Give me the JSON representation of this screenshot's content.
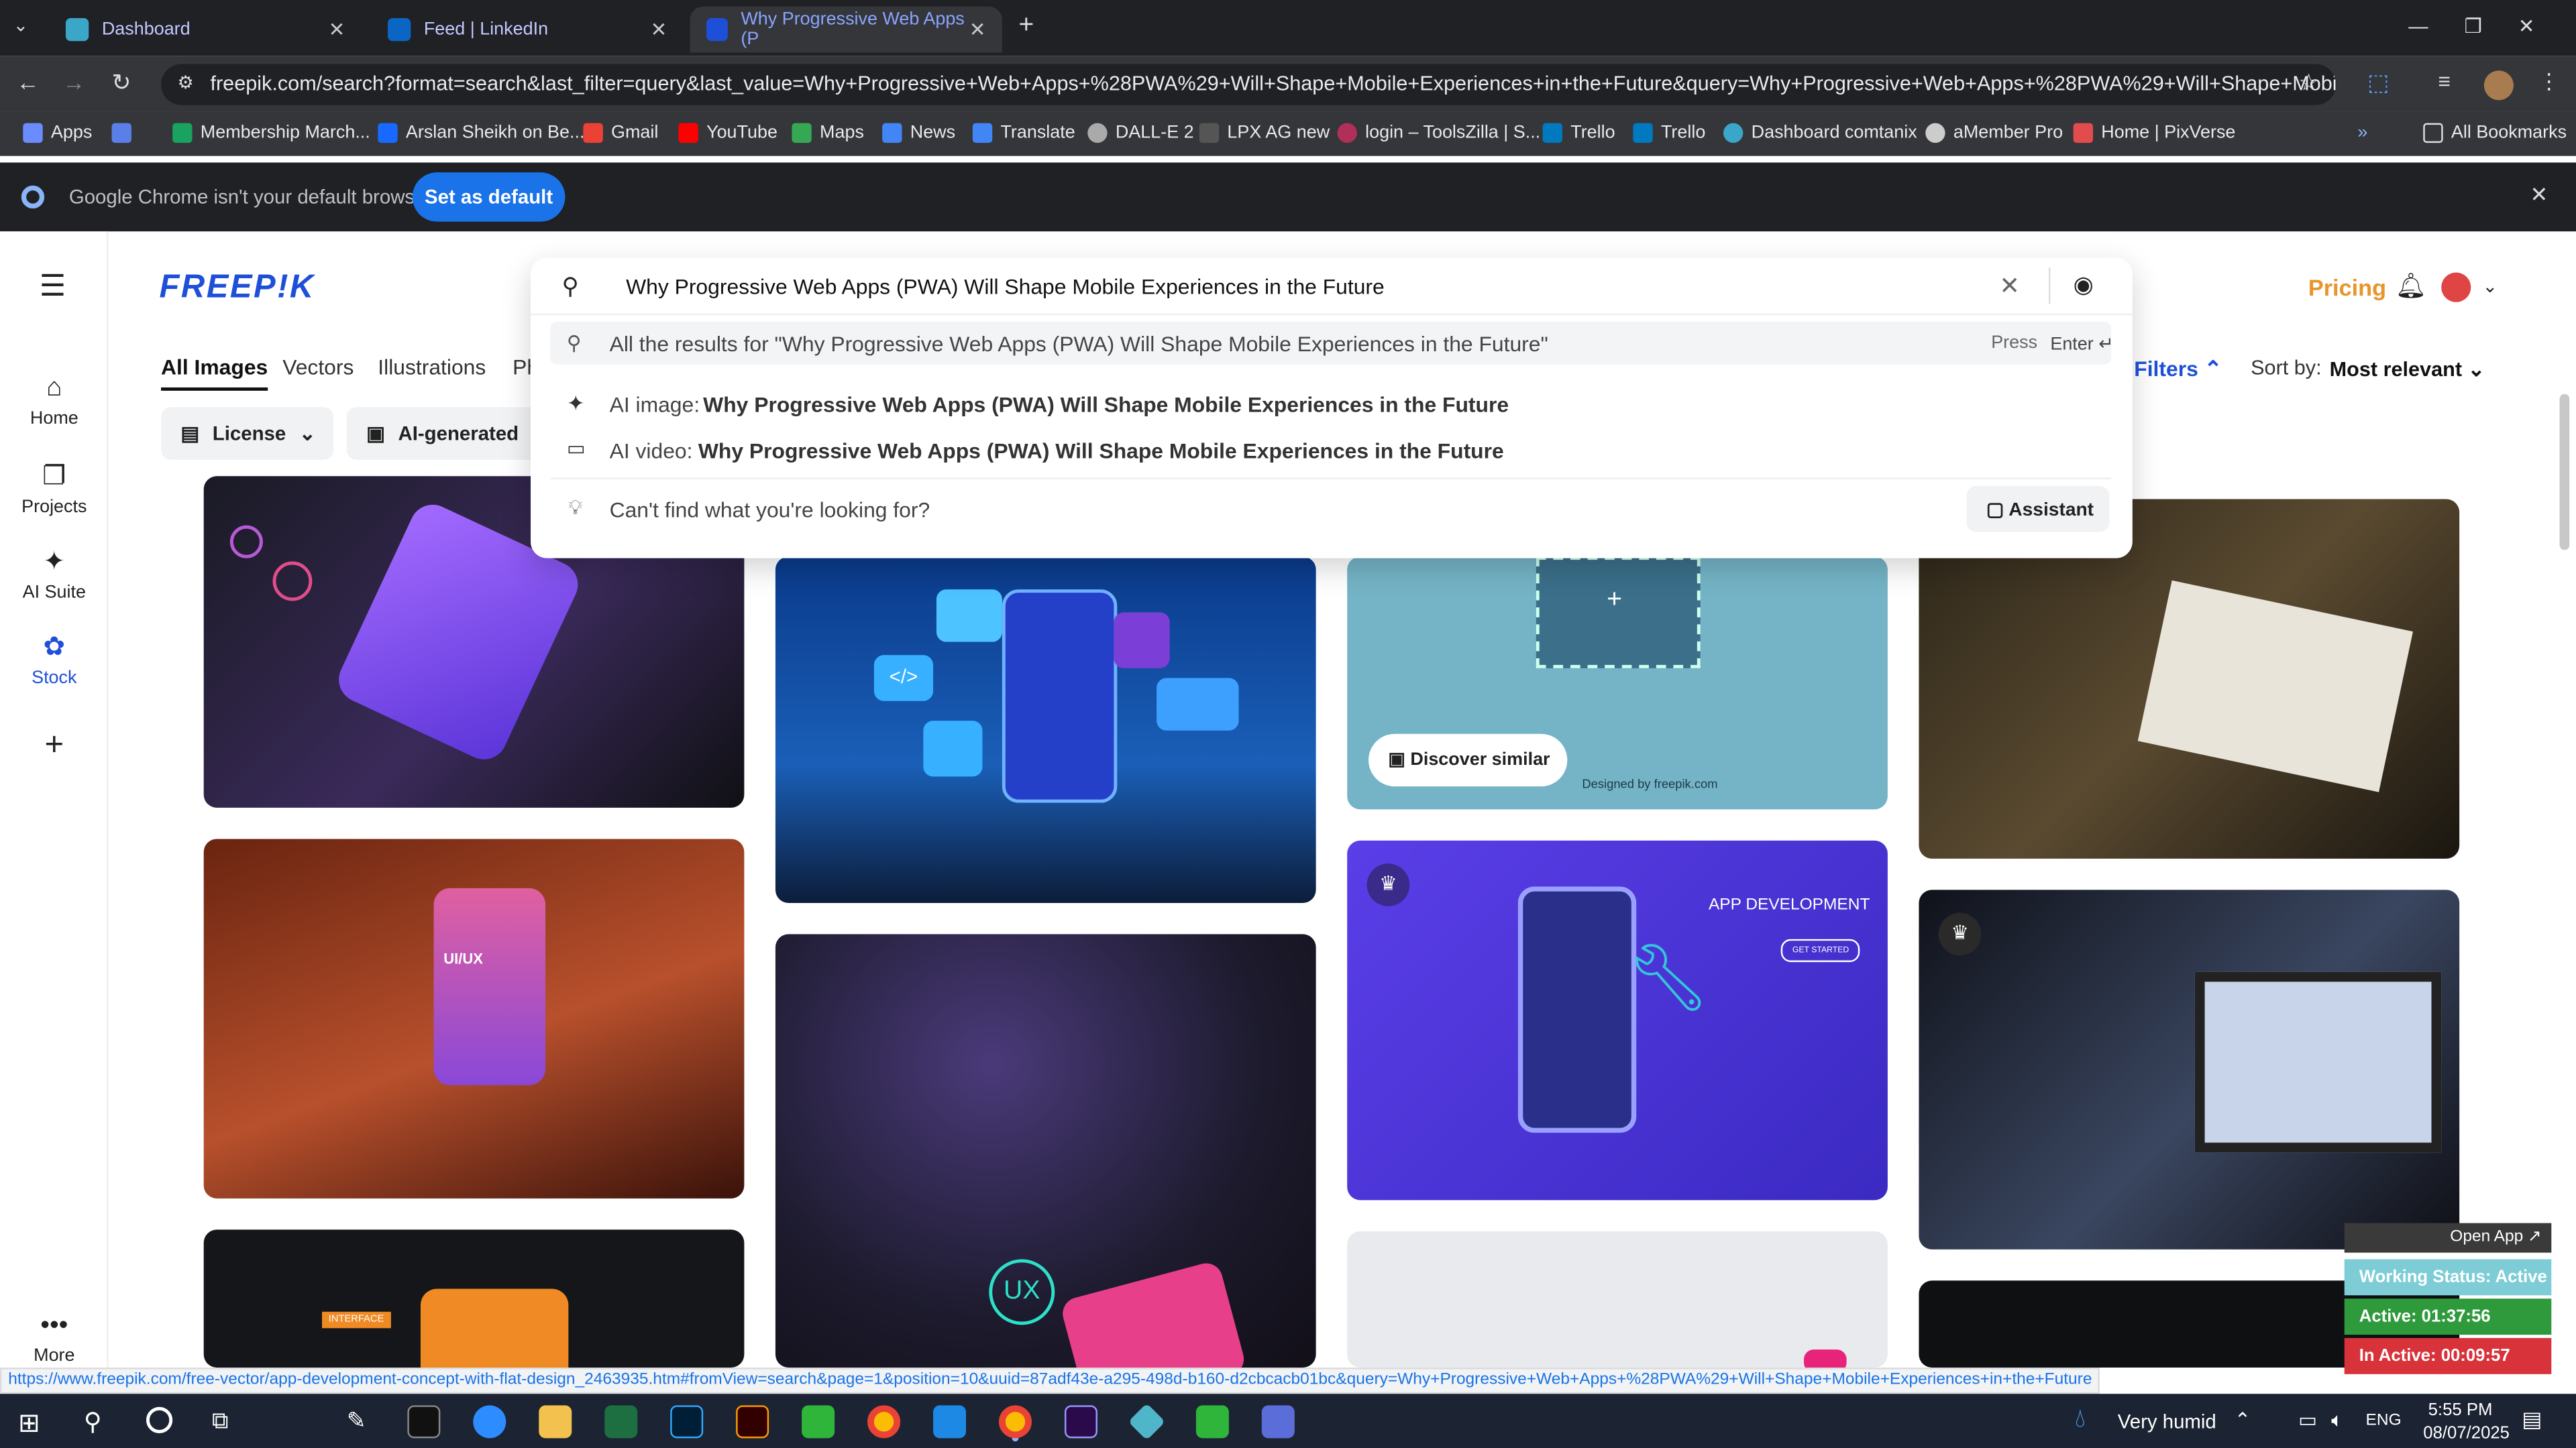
{
  "browser": {
    "tabs": [
      {
        "label": "Dashboard",
        "color": "#1c6fd1"
      },
      {
        "label": "Feed | LinkedIn",
        "color": "#0a66c2"
      },
      {
        "label": "Why Progressive Web Apps (P",
        "color": "#1e4fd8"
      }
    ],
    "url": "freepik.com/search?format=search&last_filter=query&last_value=Why+Progressive+Web+Apps+%28PWA%29+Will+Shape+Mobile+Experiences+in+the+Future&query=Why+Progressive+Web+Apps+%28PWA%29+Will+Shape+Mobile+Experien...",
    "bookmarks": [
      {
        "label": "Apps"
      },
      {
        "label": "Membership March..."
      },
      {
        "label": "Arslan Sheikh on Be..."
      },
      {
        "label": "Gmail"
      },
      {
        "label": "YouTube"
      },
      {
        "label": "Maps"
      },
      {
        "label": "News"
      },
      {
        "label": "Translate"
      },
      {
        "label": "DALL-E 2"
      },
      {
        "label": "LPX AG new"
      },
      {
        "label": "login – ToolsZilla | S..."
      },
      {
        "label": "Trello"
      },
      {
        "label": "Trello"
      },
      {
        "label": "Dashboard comtanix"
      },
      {
        "label": "aMember Pro"
      },
      {
        "label": "Home | PixVerse"
      }
    ],
    "all_bookmarks": "All Bookmarks",
    "default_msg": "Google Chrome isn't your default browser",
    "set_default": "Set as default",
    "status_url": "https://www.freepik.com/free-vector/app-development-concept-with-flat-design_2463935.htm#fromView=search&page=1&position=10&uuid=87adf43e-a295-498d-b160-d2cbcacb01bc&query=Why+Progressive+Web+Apps+%28PWA%29+Will+Shape+Mobile+Experiences+in+the+Future"
  },
  "freepik": {
    "logo": "FREEP!K",
    "nav": [
      {
        "label": "Home",
        "icon": "home-icon"
      },
      {
        "label": "Projects",
        "icon": "projects-icon"
      },
      {
        "label": "AI Suite",
        "icon": "ai-suite-icon"
      },
      {
        "label": "Stock",
        "icon": "stock-icon"
      }
    ],
    "more": "More",
    "pricing": "Pricing",
    "tabs": [
      "All Images",
      "Vectors",
      "Illustrations",
      "Ph"
    ],
    "license": "License",
    "ai_generated": "AI-generated",
    "filters": "Filters",
    "sort_label": "Sort by:",
    "sort_value": "Most relevant",
    "search_value": "Why Progressive Web Apps (PWA) Will Shape Mobile Experiences in the Future",
    "dropdown": {
      "all_results": "All the results for \"Why Progressive Web Apps (PWA) Will Shape Mobile Experiences in the Future\"",
      "press": "Press",
      "enter": "Enter",
      "ai_image_prefix": "AI image:",
      "ai_image_text": "Why Progressive Web Apps (PWA) Will Shape Mobile Experiences in the Future",
      "ai_video_prefix": "AI video:",
      "ai_video_text": "Why Progressive Web Apps (PWA) Will Shape Mobile Experiences in the Future",
      "cant_find": "Can't find what you're looking for?",
      "assistant": "Assistant"
    },
    "discover_similar": "Discover similar",
    "designed_by": "Designed by freepik.com",
    "app_dev": "APP DEVELOPMENT",
    "get_started": "GET STARTED",
    "ui_ux": "UI/UX",
    "ux": "UX",
    "interface": "INTERFACE"
  },
  "widget": {
    "open_app": "Open App",
    "working": "Working Status: Active",
    "active": "Active: 01:37:56",
    "inactive": "In Active: 00:09:57"
  },
  "taskbar": {
    "weather": "Very humid",
    "lang": "ENG",
    "time": "5:55 PM",
    "date": "08/07/2025"
  }
}
